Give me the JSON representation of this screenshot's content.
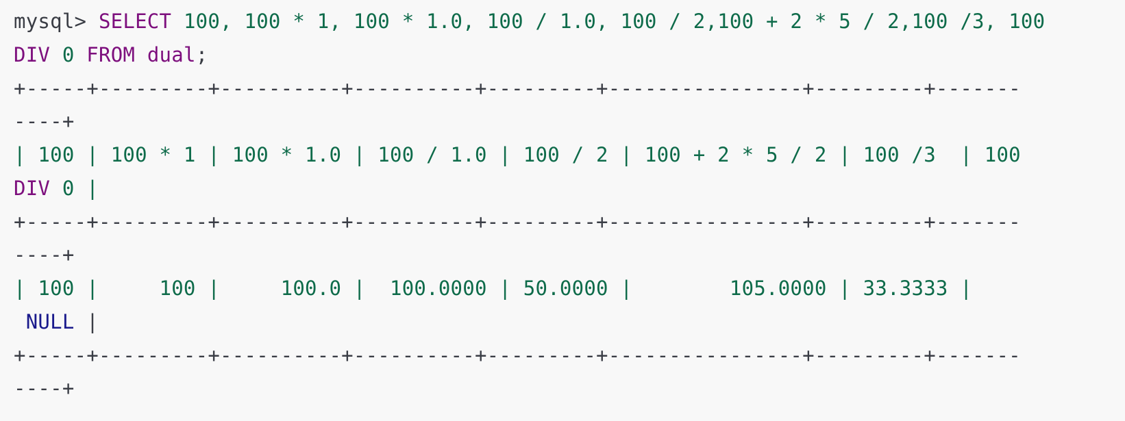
{
  "colors": {
    "background": "#f8f8f8",
    "plain_text": "#3a3d45",
    "keyword": "#7d0f7d",
    "number": "#0e6b4a",
    "null_literal": "#1a1a8c"
  },
  "code": {
    "line1": {
      "prompt": "mysql> ",
      "select": "SELECT",
      "exprs": " 100, 100 * 1, 100 * 1.0, 100 / 1.0, 100 / 2,100 + 2 * 5 / 2,100 /3, 100"
    },
    "line2": {
      "div": "DIV",
      "zero": " 0",
      "from": " FROM",
      "table": " dual",
      "semicolon": ";"
    },
    "border_main": "+-----+---------+----------+----------+---------+----------------+---------+-------",
    "border_tail": "----+",
    "header1": "| 100 | 100 * 1 | 100 * 1.0 | 100 / 1.0 | 100 / 2 | 100 + 2 * 5 / 2 | 100 /3  | 100",
    "header2": {
      "div": "DIV",
      "rest": " 0 |"
    },
    "row1": "| 100 |     100 |     100.0 |  100.0000 | 50.0000 |        105.0000 | 33.3333 |",
    "row2": {
      "null": " NULL",
      "rest": " |"
    }
  }
}
